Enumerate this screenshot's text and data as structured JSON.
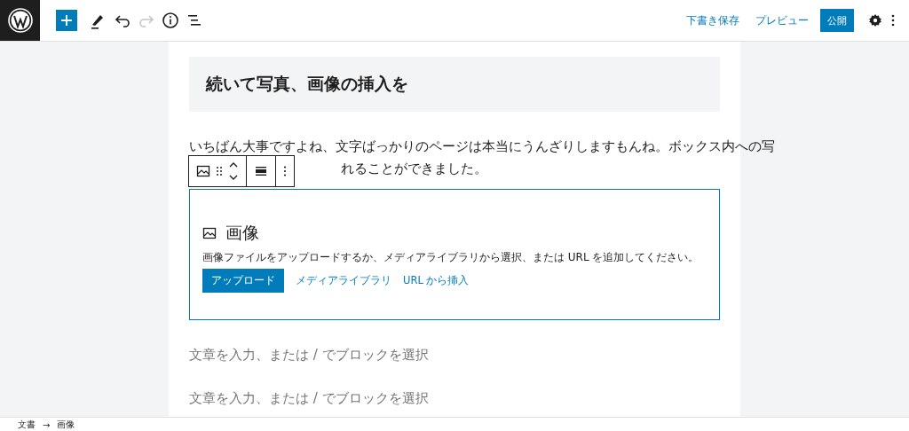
{
  "top_bar": {
    "tools": [
      {
        "kind": "add",
        "disabled": false
      },
      {
        "kind": "edit",
        "disabled": false
      },
      {
        "kind": "undo",
        "disabled": false
      },
      {
        "kind": "redo",
        "disabled": true
      },
      {
        "kind": "info",
        "disabled": false
      },
      {
        "kind": "outline",
        "disabled": false
      }
    ],
    "save_draft": "下書き保存",
    "preview": "プレビュー",
    "publish": "公開"
  },
  "blocks": [
    {
      "kind": "heading",
      "text": "続いて写真、画像の挿入を"
    },
    {
      "kind": "paragraph",
      "lines": [
        "いちばん大事ですよね、文字ばっかりのページは本当にうんざりしますもんね。ボックス内への写",
        "れることができました。"
      ]
    },
    {
      "kind": "image",
      "selected": true,
      "title": "画像",
      "description": "画像ファイルをアップロードするか、メディアライブラリから選択、または URL を追加してください。",
      "upload": "アップロード",
      "media_library": "メディアライブラリ",
      "insert_url": "URL から挿入"
    },
    {
      "kind": "placeholder",
      "text": "文章を入力、または / でブロックを選択"
    },
    {
      "kind": "placeholder",
      "text": "文章を入力、または / でブロックを選択"
    }
  ],
  "breadcrumb": [
    "文書",
    "→",
    "画像"
  ]
}
